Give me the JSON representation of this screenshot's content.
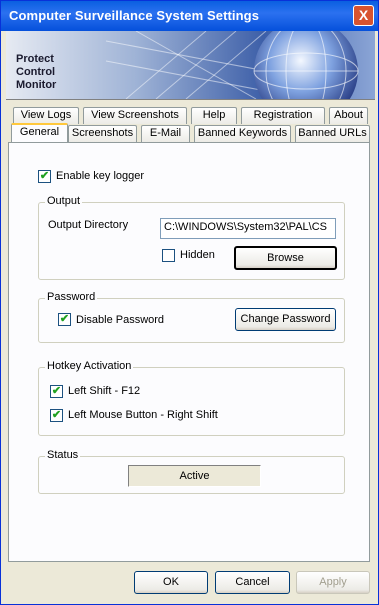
{
  "window": {
    "title": "Computer Surveillance System Settings",
    "close_glyph": "X"
  },
  "banner": {
    "logo_lines": [
      "Protect",
      "Control",
      "Monitor"
    ]
  },
  "tabs_back": [
    "View Logs",
    "View Screenshots",
    "Help",
    "Registration",
    "About"
  ],
  "tabs_front": [
    "General",
    "Screenshots",
    "E-Mail",
    "Banned Keywords",
    "Banned URLs"
  ],
  "active_tab": "General",
  "general": {
    "keylogger_label": "Enable key logger",
    "keylogger_checked": true,
    "output": {
      "legend": "Output",
      "dir_label": "Output Directory",
      "dir_value": "C:\\WINDOWS\\System32\\PAL\\CS",
      "hidden_label": "Hidden",
      "hidden_checked": false,
      "browse_label": "Browse"
    },
    "password": {
      "legend": "Password",
      "disable_label": "Disable Password",
      "disable_checked": true,
      "change_label": "Change Password"
    },
    "hotkey": {
      "legend": "Hotkey Activation",
      "shift_label": "Left Shift - F12",
      "shift_checked": true,
      "mouse_label": "Left Mouse Button - Right Shift",
      "mouse_checked": true
    },
    "status": {
      "legend": "Status",
      "value": "Active"
    }
  },
  "buttons": {
    "ok": "OK",
    "cancel": "Cancel",
    "apply": "Apply"
  },
  "colors": {
    "titlebar": "#0A5FE0",
    "face": "#ECE9D8",
    "panel": "#FCFCFE",
    "check": "#21A121"
  }
}
